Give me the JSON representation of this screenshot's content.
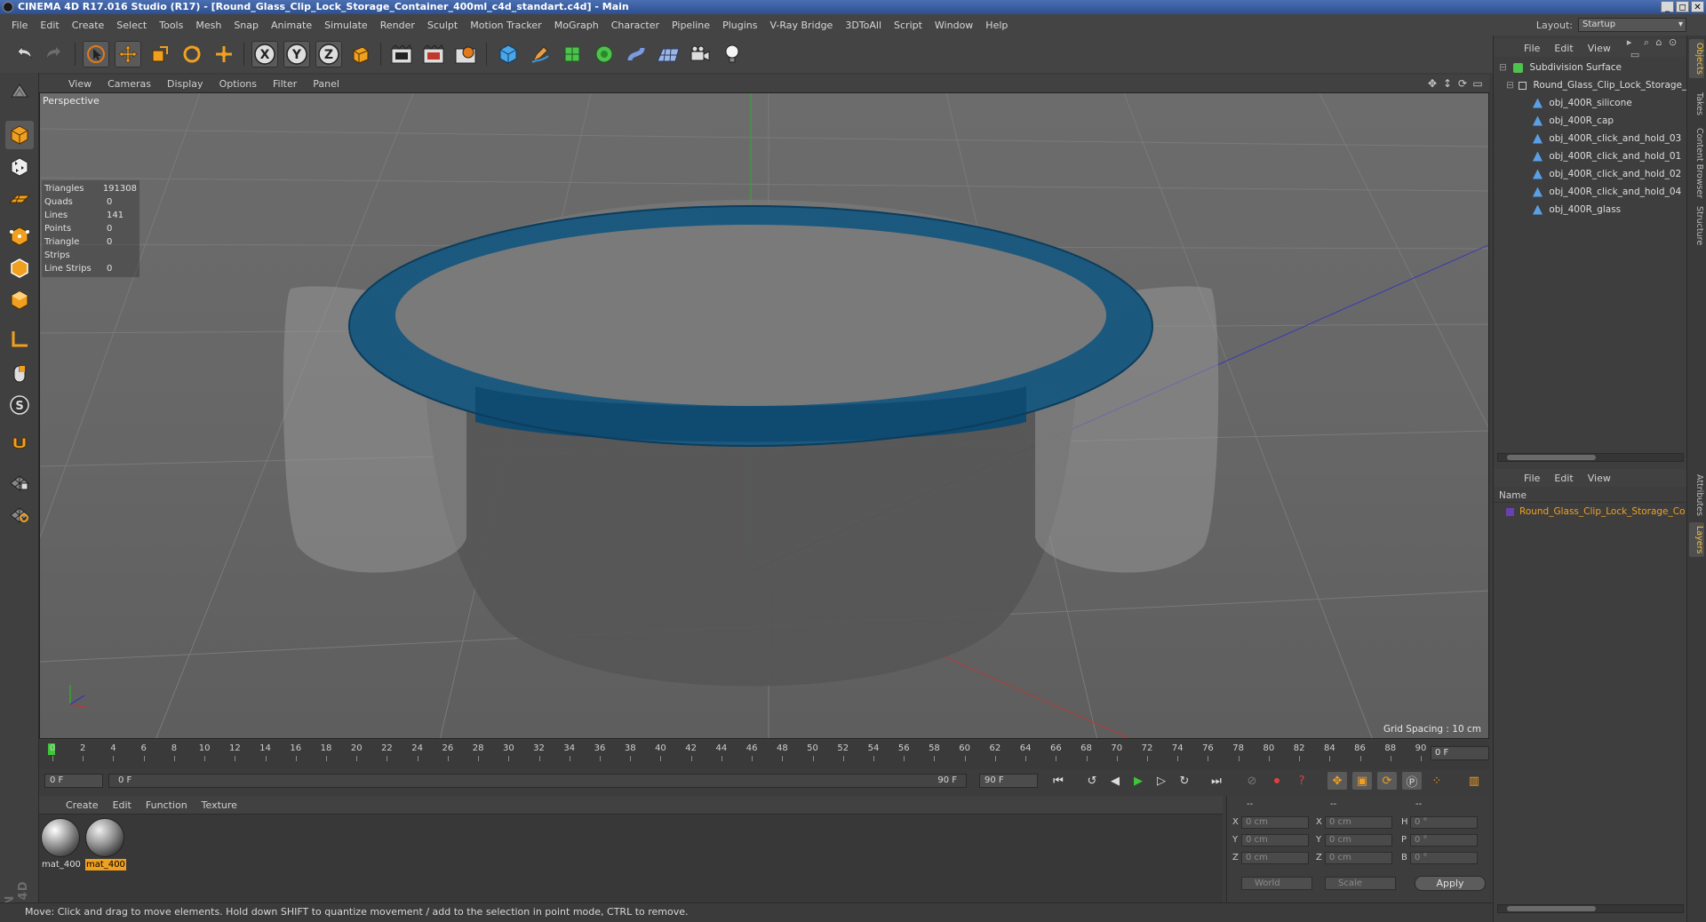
{
  "window": {
    "title": "CINEMA 4D R17.016 Studio (R17) - [Round_Glass_Clip_Lock_Storage_Container_400ml_c4d_standart.c4d] - Main",
    "controls": [
      "_",
      "◻",
      "✕"
    ]
  },
  "menu": [
    "File",
    "Edit",
    "Create",
    "Select",
    "Tools",
    "Mesh",
    "Snap",
    "Animate",
    "Simulate",
    "Render",
    "Sculpt",
    "Motion Tracker",
    "MoGraph",
    "Character",
    "Pipeline",
    "Plugins",
    "V-Ray Bridge",
    "3DToAll",
    "Script",
    "Window",
    "Help"
  ],
  "layout": {
    "label": "Layout:",
    "value": "Startup"
  },
  "toolbar": {
    "x_label": "X",
    "y_label": "Y",
    "z_label": "Z",
    "icons": [
      "undo-icon",
      "redo-icon",
      "select-arrow-icon",
      "move-icon",
      "scale-icon",
      "rotate-icon",
      "transform-icon",
      "axis-x-icon",
      "axis-y-icon",
      "axis-z-icon",
      "world-coords-icon",
      "render-view-icon",
      "render-picture-viewer-icon",
      "render-settings-icon",
      "cube-icon",
      "pen-icon",
      "subdivision-icon",
      "array-icon",
      "deformer-icon",
      "floor-icon",
      "camera-icon",
      "light-icon"
    ]
  },
  "left_toolbar": {
    "icons": [
      "make-editable-icon",
      "model-mode-icon",
      "texture-mode-icon",
      "workplane-icon",
      "points-mode-icon",
      "edges-mode-icon",
      "polygons-mode-icon",
      "axis-mode-icon",
      "tweak-mode-icon",
      "solo-icon",
      "magnet-icon",
      "snap-grid-icon",
      "snap-settings-icon"
    ]
  },
  "logo": {
    "line1": "MAXON",
    "line2": "CINEMA 4D"
  },
  "viewport": {
    "menu": [
      "View",
      "Cameras",
      "Display",
      "Options",
      "Filter",
      "Panel"
    ],
    "label": "Perspective",
    "stats": [
      {
        "label": "Triangles",
        "value": "191308"
      },
      {
        "label": "Quads",
        "value": "0"
      },
      {
        "label": "Lines",
        "value": "141"
      },
      {
        "label": "Points",
        "value": "0"
      },
      {
        "label": "Triangle Strips",
        "value": "0"
      },
      {
        "label": "Line Strips",
        "value": "0"
      }
    ],
    "grid_spacing": "Grid Spacing : 10 cm",
    "colors": {
      "background": "#6a6a6a",
      "silicone": "#1c5a82",
      "x_axis": "#b23a3a",
      "y_axis": "#3aa33a",
      "z_axis": "#3a3ab2"
    }
  },
  "timeline": {
    "ticks": [
      "0",
      "2",
      "4",
      "6",
      "8",
      "10",
      "12",
      "14",
      "16",
      "18",
      "20",
      "22",
      "24",
      "26",
      "28",
      "30",
      "32",
      "34",
      "36",
      "38",
      "40",
      "42",
      "44",
      "46",
      "48",
      "50",
      "52",
      "54",
      "56",
      "58",
      "60",
      "62",
      "64",
      "66",
      "68",
      "70",
      "72",
      "74",
      "76",
      "78",
      "80",
      "82",
      "84",
      "86",
      "88",
      "90"
    ],
    "current_frame": "0 F"
  },
  "transport": {
    "start_field": "0 F",
    "min_field": "0 F",
    "max_label": "90 F",
    "end_field": "90 F",
    "icons": [
      "go-to-start-icon",
      "previous-key-icon",
      "previous-frame-icon",
      "play-icon",
      "next-frame-icon",
      "next-key-icon",
      "go-to-end-icon",
      "record-icon",
      "autokey-icon",
      "keyframe-selection-icon",
      "position-key-icon",
      "scale-key-icon",
      "rotation-key-icon",
      "param-key-icon",
      "pla-key-icon",
      "timeline-icon"
    ]
  },
  "materials": {
    "menu": [
      "Create",
      "Edit",
      "Function",
      "Texture"
    ],
    "items": [
      {
        "name": "mat_400",
        "selected": false
      },
      {
        "name": "mat_400",
        "selected": true
      }
    ]
  },
  "coordinates": {
    "headers": [
      "--",
      "--",
      "--"
    ],
    "rows": [
      {
        "axis": "X",
        "pos": "0 cm",
        "axis2": "X",
        "size": "0 cm",
        "axis3": "H",
        "rot": "0 °"
      },
      {
        "axis": "Y",
        "pos": "0 cm",
        "axis2": "Y",
        "size": "0 cm",
        "axis3": "P",
        "rot": "0 °"
      },
      {
        "axis": "Z",
        "pos": "0 cm",
        "axis2": "Z",
        "size": "0 cm",
        "axis3": "B",
        "rot": "0 °"
      }
    ],
    "mode_select": "World",
    "size_select": "Scale",
    "apply_label": "Apply"
  },
  "status": "Move: Click and drag to move elements. Hold down SHIFT to quantize movement / add to the selection in point mode, CTRL to remove.",
  "objects": {
    "menu": [
      "File",
      "Edit",
      "View"
    ],
    "items": [
      {
        "label": "Subdivision Surface",
        "depth": 0,
        "icon": "subdivision-surface-icon"
      },
      {
        "label": "Round_Glass_Clip_Lock_Storage_C",
        "depth": 1,
        "icon": "null-object-icon"
      },
      {
        "label": "obj_400R_silicone",
        "depth": 2,
        "icon": "polygon-object-icon"
      },
      {
        "label": "obj_400R_cap",
        "depth": 2,
        "icon": "polygon-object-icon"
      },
      {
        "label": "obj_400R_click_and_hold_03",
        "depth": 2,
        "icon": "polygon-object-icon"
      },
      {
        "label": "obj_400R_click_and_hold_01",
        "depth": 2,
        "icon": "polygon-object-icon"
      },
      {
        "label": "obj_400R_click_and_hold_02",
        "depth": 2,
        "icon": "polygon-object-icon"
      },
      {
        "label": "obj_400R_click_and_hold_04",
        "depth": 2,
        "icon": "polygon-object-icon"
      },
      {
        "label": "obj_400R_glass",
        "depth": 2,
        "icon": "polygon-object-icon"
      }
    ]
  },
  "layers": {
    "menu": [
      "File",
      "Edit",
      "View"
    ],
    "header": "Name",
    "row": "Round_Glass_Clip_Lock_Storage_Co"
  },
  "side_tabs": {
    "top": [
      "Objects",
      "Takes",
      "Content Browser",
      "Structure"
    ],
    "bottom": [
      "Attributes",
      "Layers"
    ]
  }
}
